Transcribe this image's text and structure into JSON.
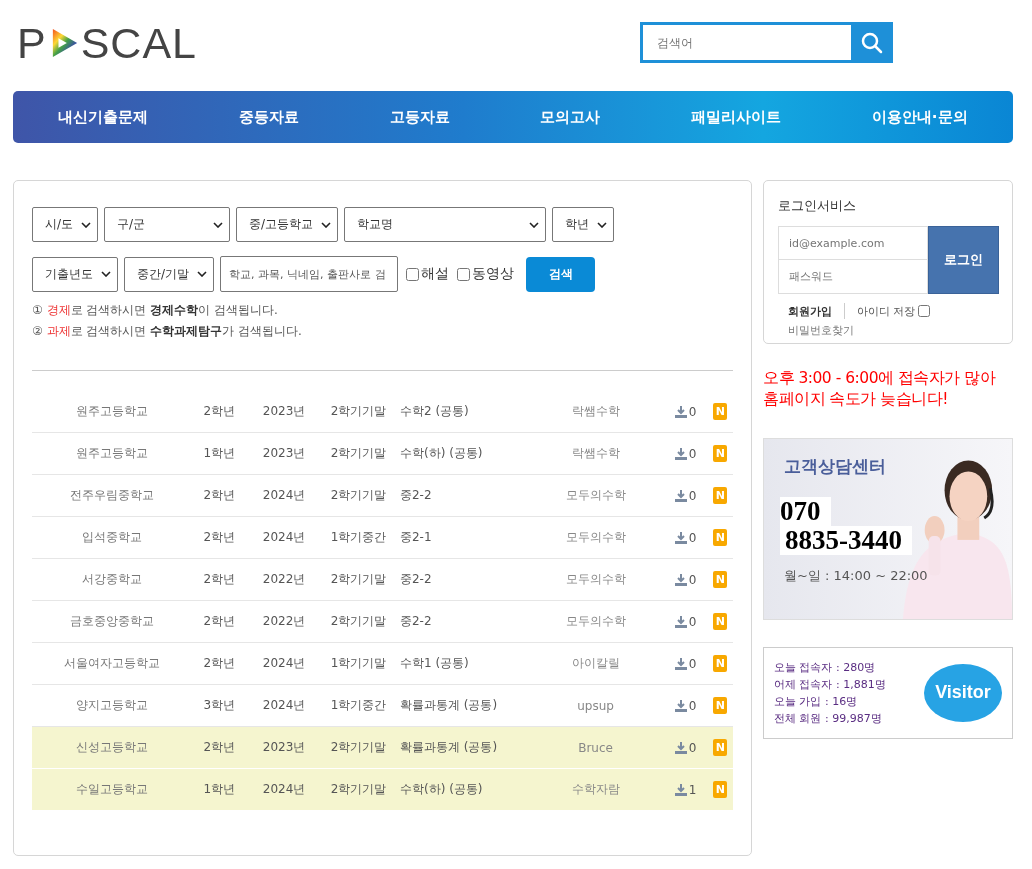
{
  "logo": {
    "parts": [
      "P",
      "SCAL"
    ]
  },
  "search": {
    "placeholder": "검색어"
  },
  "nav": [
    "내신기출문제",
    "중등자료",
    "고등자료",
    "모의고사",
    "패밀리사이트",
    "이용안내·문의"
  ],
  "filters": {
    "row1": [
      "시/도",
      "구/군",
      "중/고등학교",
      "학교명",
      "학년"
    ],
    "row2": [
      "기출년도",
      "중간/기말"
    ],
    "keyword": {
      "placeholder": "학교, 과목, 닉네임, 출판사로 검"
    },
    "checks": [
      {
        "label": "해설",
        "checked": false
      },
      {
        "label": "동영상",
        "checked": false
      }
    ],
    "button": "검색"
  },
  "hints": [
    {
      "num": "①",
      "keyword": "경제",
      "text": "로 검색하시면 **경제수학**이 검색됩니다."
    },
    {
      "num": "②",
      "keyword": "과제",
      "text": "로 검색하시면 **수학과제탐구**가 검색됩니다."
    }
  ],
  "rows": [
    {
      "school": "원주고등학교",
      "grade": "2학년",
      "year": "2023년",
      "term": "2학기기말",
      "subject": "수학2 (공통)",
      "author": "락쌤수학",
      "downloads": "0",
      "badge": "N",
      "highlighted": false
    },
    {
      "school": "원주고등학교",
      "grade": "1학년",
      "year": "2023년",
      "term": "2학기기말",
      "subject": "수학(하) (공통)",
      "author": "락쌤수학",
      "downloads": "0",
      "badge": "N",
      "highlighted": false
    },
    {
      "school": "전주우림중학교",
      "grade": "2학년",
      "year": "2024년",
      "term": "2학기기말",
      "subject": "중2-2",
      "author": "모두의수학",
      "downloads": "0",
      "badge": "N",
      "highlighted": false
    },
    {
      "school": "입석중학교",
      "grade": "2학년",
      "year": "2024년",
      "term": "1학기중간",
      "subject": "중2-1",
      "author": "모두의수학",
      "downloads": "0",
      "badge": "N",
      "highlighted": false
    },
    {
      "school": "서강중학교",
      "grade": "2학년",
      "year": "2022년",
      "term": "2학기기말",
      "subject": "중2-2",
      "author": "모두의수학",
      "downloads": "0",
      "badge": "N",
      "highlighted": false
    },
    {
      "school": "금호중앙중학교",
      "grade": "2학년",
      "year": "2022년",
      "term": "2학기기말",
      "subject": "중2-2",
      "author": "모두의수학",
      "downloads": "0",
      "badge": "N",
      "highlighted": false
    },
    {
      "school": "서울여자고등학교",
      "grade": "2학년",
      "year": "2024년",
      "term": "1학기기말",
      "subject": "수학1 (공통)",
      "author": "아이칼릴",
      "downloads": "0",
      "badge": "N",
      "highlighted": false
    },
    {
      "school": "양지고등학교",
      "grade": "3학년",
      "year": "2024년",
      "term": "1학기중간",
      "subject": "확률과통계 (공통)",
      "author": "upsup",
      "downloads": "0",
      "badge": "N",
      "highlighted": false
    },
    {
      "school": "신성고등학교",
      "grade": "2학년",
      "year": "2023년",
      "term": "2학기기말",
      "subject": "확률과통계 (공통)",
      "author": "Bruce",
      "downloads": "0",
      "badge": "N",
      "highlighted": true
    },
    {
      "school": "수일고등학교",
      "grade": "1학년",
      "year": "2024년",
      "term": "2학기기말",
      "subject": "수학(하) (공통)",
      "author": "수학자람",
      "downloads": "1",
      "badge": "N",
      "highlighted": true
    }
  ],
  "login": {
    "title": "로그인서비스",
    "id_placeholder": "id@example.com",
    "pw_placeholder": "패스워드",
    "button": "로그인",
    "join": "회원가입",
    "remember": {
      "label": "아이디 저장",
      "checked": false
    },
    "find": "비밀번호찾기"
  },
  "notice": "오후 3:00 - 6:00에 접속자가 많아 홈페이지 속도가 늦습니다!",
  "support": {
    "kind": "picture",
    "title": "고객상담센터",
    "phone": [
      "070",
      "8835-3440"
    ],
    "hours": "월~일 : 14:00 ~ 22:00"
  },
  "visitors": {
    "lines": [
      "오늘 접속자 : 280명",
      "어제 접속자 : 1,881명",
      "오늘 가입 : 16명",
      "전체 회원 : 99,987명"
    ],
    "badge": "Visitor"
  }
}
